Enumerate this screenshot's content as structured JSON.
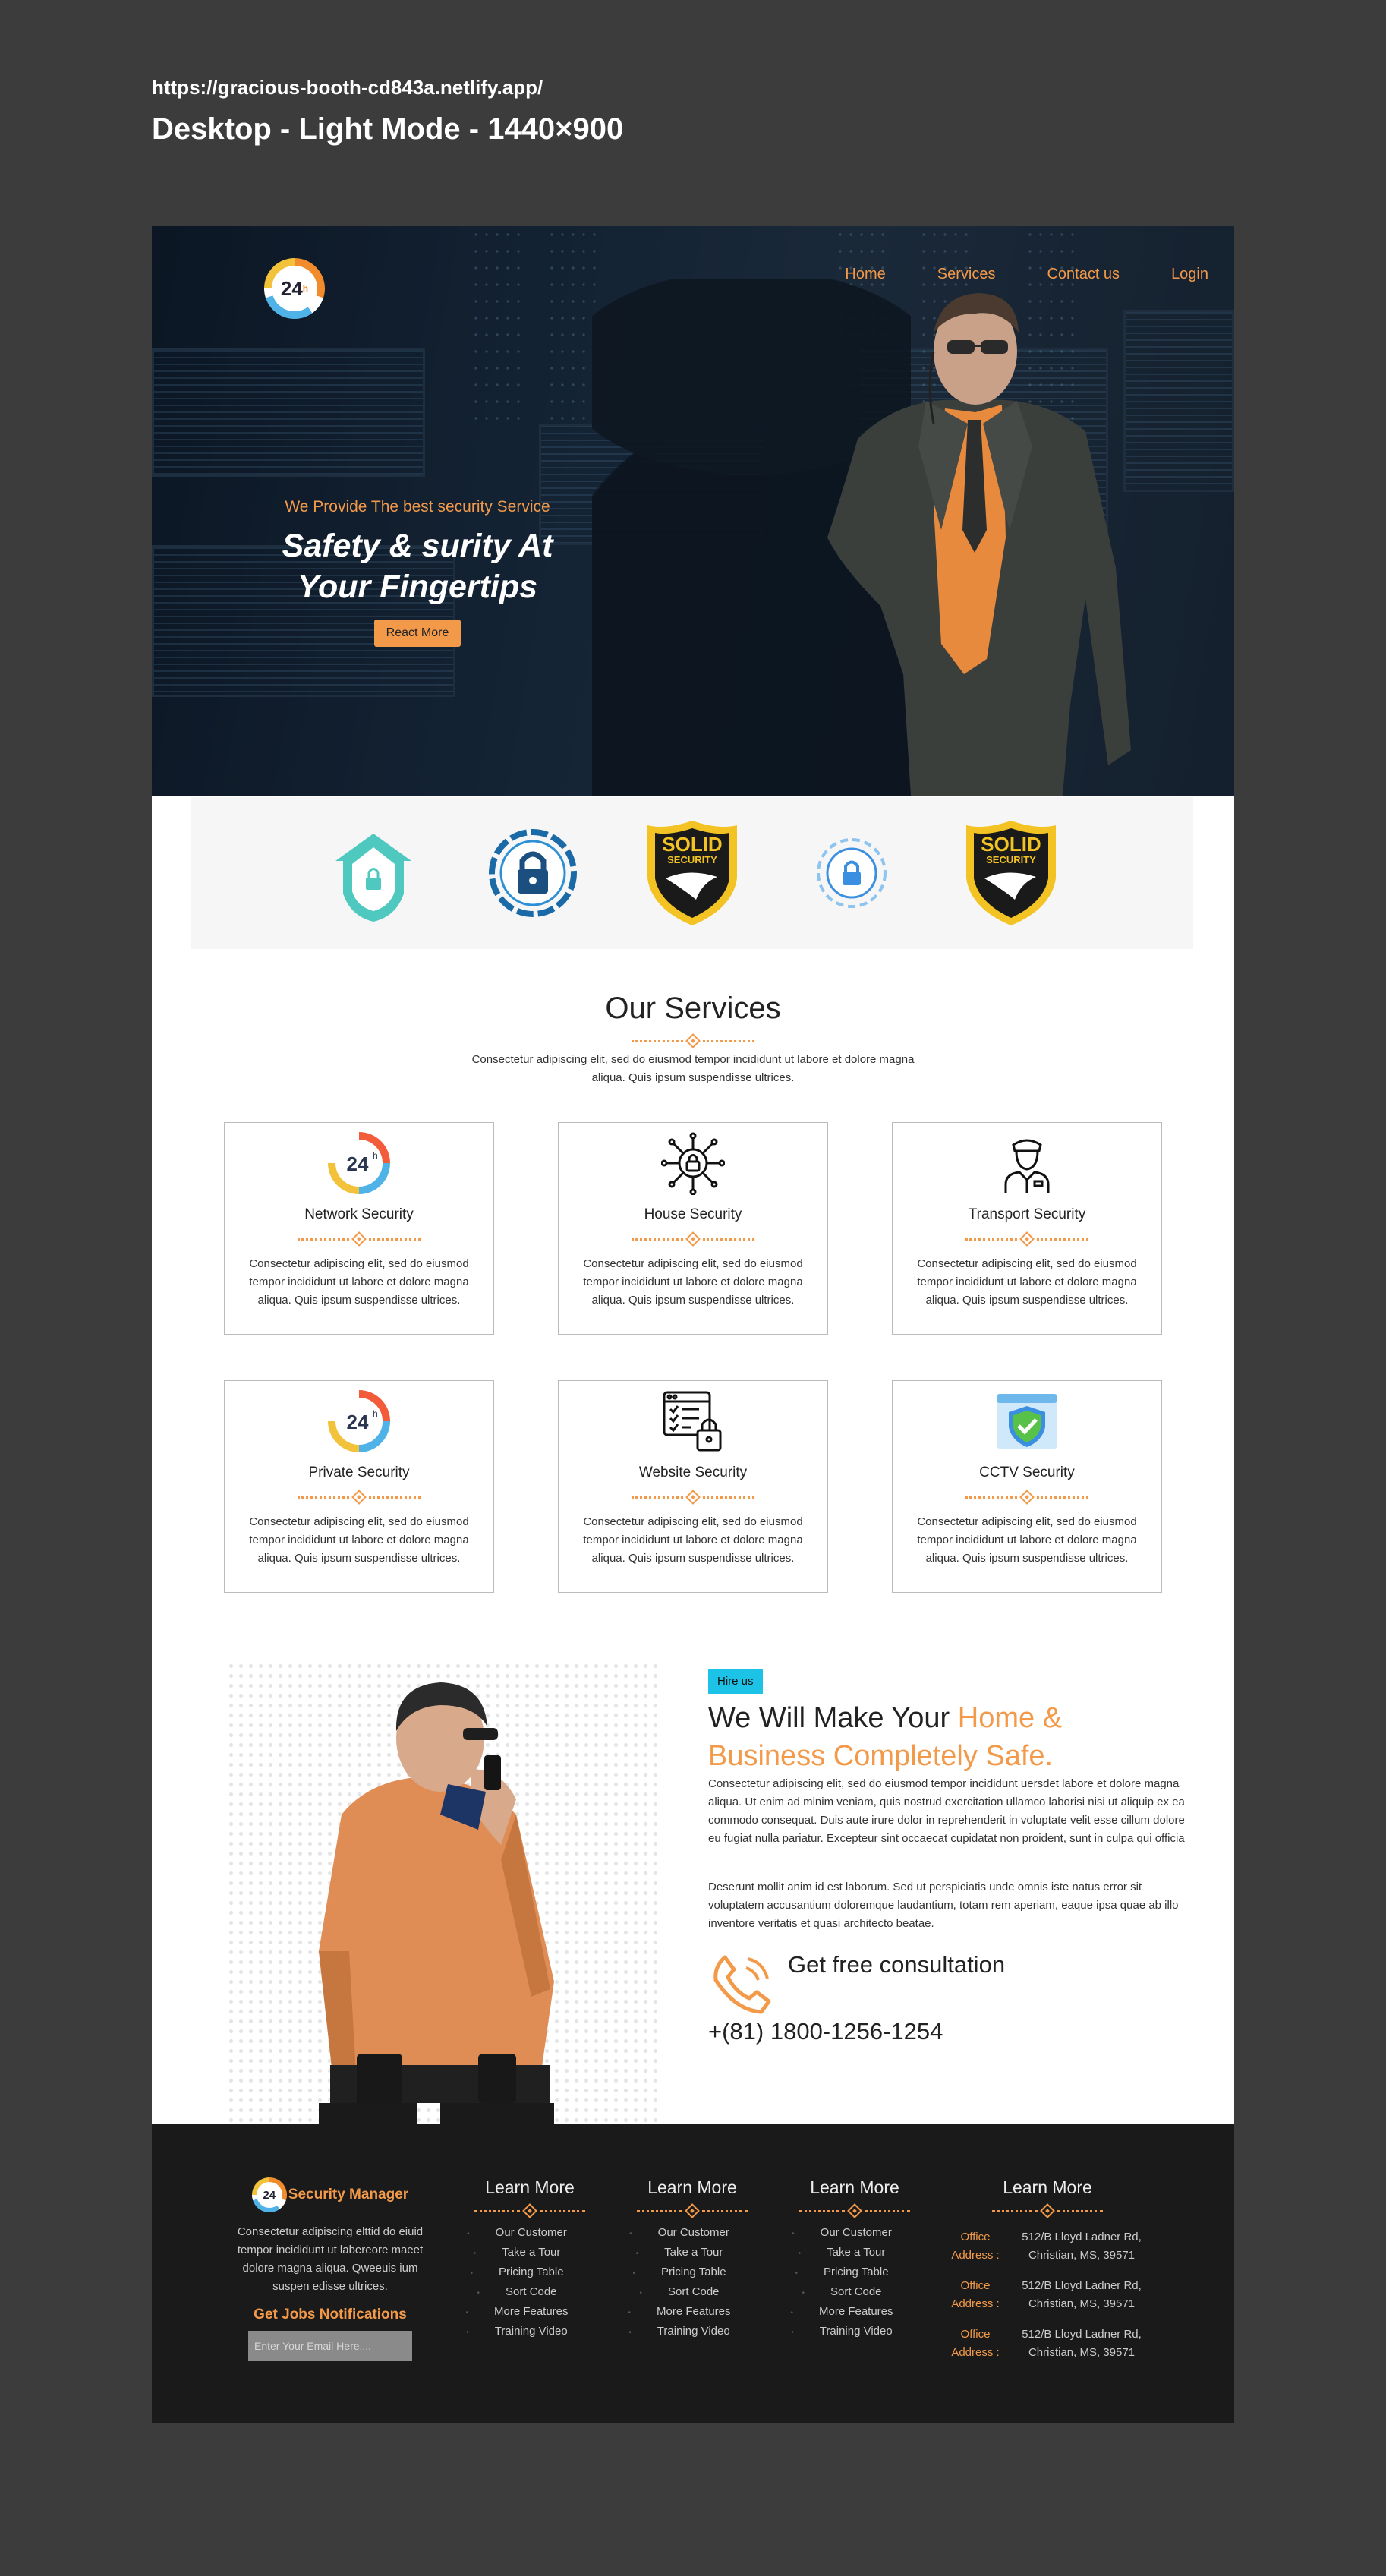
{
  "meta": {
    "url": "https://gracious-booth-cd843a.netlify.app/",
    "title": "Desktop - Light Mode - 1440×900"
  },
  "colors": {
    "accent": "#f39a4a",
    "tag": "#1cc3e7",
    "footer_bg": "#1a1a1a"
  },
  "header": {
    "logo_text": "24",
    "logo_sup": "h",
    "nav": [
      "Home",
      "Services",
      "Contact us",
      "Login"
    ]
  },
  "hero": {
    "kicker": "We Provide The best security Service",
    "title_line1": "Safety & surity At",
    "title_line2": "Your Fingertips",
    "button": "React More"
  },
  "badges": [
    {
      "icon": "home-shield-icon"
    },
    {
      "icon": "padlock-ring-icon"
    },
    {
      "icon": "solid-security-shield-icon",
      "text1": "SOLID",
      "text2": "SECURITY"
    },
    {
      "icon": "digital-lock-icon"
    },
    {
      "icon": "solid-security-shield-icon",
      "text1": "SOLID",
      "text2": "SECURITY"
    }
  ],
  "services": {
    "title": "Our Services",
    "description": "Consectetur adipiscing elit, sed do eiusmod tempor incididunt ut labore et dolore magna aliqua. Quis ipsum suspendisse ultrices.",
    "cards": [
      {
        "title": "Network Security",
        "icon": "24h-icon",
        "desc": "Consectetur adipiscing elit, sed do eiusmod tempor incididunt ut labore et dolore magna aliqua. Quis ipsum suspendisse ultrices."
      },
      {
        "title": "House Security",
        "icon": "circuit-lock-icon",
        "desc": "Consectetur adipiscing elit, sed do eiusmod tempor incididunt ut labore et dolore magna aliqua. Quis ipsum suspendisse ultrices."
      },
      {
        "title": "Transport Security",
        "icon": "security-guard-icon",
        "desc": "Consectetur adipiscing elit, sed do eiusmod tempor incididunt ut labore et dolore magna aliqua. Quis ipsum suspendisse ultrices."
      },
      {
        "title": "Private Security",
        "icon": "24h-icon",
        "desc": "Consectetur adipiscing elit, sed do eiusmod tempor incididunt ut labore et dolore magna aliqua. Quis ipsum suspendisse ultrices."
      },
      {
        "title": "Website Security",
        "icon": "website-lock-icon",
        "desc": "Consectetur adipiscing elit, sed do eiusmod tempor incididunt ut labore et dolore magna aliqua. Quis ipsum suspendisse ultrices."
      },
      {
        "title": "CCTV Security",
        "icon": "shield-check-window-icon",
        "desc": "Consectetur adipiscing elit, sed do eiusmod tempor incididunt ut labore et dolore magna aliqua. Quis ipsum suspendisse ultrices."
      }
    ]
  },
  "hire": {
    "tag": "Hire us",
    "title_plain": "We Will Make Your ",
    "title_accent_1": "Home &",
    "title_accent_2": "Business Completely Safe.",
    "para1": "Consectetur adipiscing elit, sed do eiusmod tempor incididunt uersdet labore et dolore magna aliqua. Ut enim ad minim veniam, quis nostrud exercitation ullamco laborisi nisi ut aliquip ex ea commodo consequat. Duis aute irure dolor in reprehenderit in voluptate velit esse cillum dolore eu fugiat nulla pariatur. Excepteur sint occaecat cupidatat non proident, sunt in culpa qui officia",
    "para2": "Deserunt mollit anim id est laborum. Sed ut perspiciatis unde omnis iste natus error sit voluptatem accusantium doloremque laudantium, totam rem aperiam, eaque ipsa quae ab illo inventore veritatis et quasi architecto beatae.",
    "consult": "Get free consultation",
    "phone": "+(81) 1800-1256-1254"
  },
  "footer": {
    "brand_logo": "24",
    "brand": "Security Manager",
    "brand_desc": "Consectetur adipiscing elttid do eiuid tempor incididunt ut labereore maeet dolore magna aliqua. Qweeuis ium suspen edisse ultrices.",
    "jobs_title": "Get Jobs Notifications",
    "email_placeholder": "Enter Your Email Here....",
    "columns": [
      {
        "title": "Learn More",
        "links": [
          "Our Customer",
          "Take a Tour",
          "Pricing Table",
          "Sort Code",
          "More Features",
          "Training Video"
        ]
      },
      {
        "title": "Learn More",
        "links": [
          "Our Customer",
          "Take a Tour",
          "Pricing Table",
          "Sort Code",
          "More Features",
          "Training Video"
        ]
      },
      {
        "title": "Learn More",
        "links": [
          "Our Customer",
          "Take a Tour",
          "Pricing Table",
          "Sort Code",
          "More Features",
          "Training Video"
        ]
      }
    ],
    "contact_title": "Learn More",
    "addresses": [
      {
        "label_1": "Office",
        "label_2": "Address :",
        "line1": "512/B Lloyd Ladner Rd,",
        "line2": "Christian, MS, 39571"
      },
      {
        "label_1": "Office",
        "label_2": "Address :",
        "line1": "512/B Lloyd Ladner Rd,",
        "line2": "Christian, MS, 39571"
      },
      {
        "label_1": "Office",
        "label_2": "Address :",
        "line1": "512/B Lloyd Ladner Rd,",
        "line2": "Christian, MS, 39571"
      }
    ]
  }
}
